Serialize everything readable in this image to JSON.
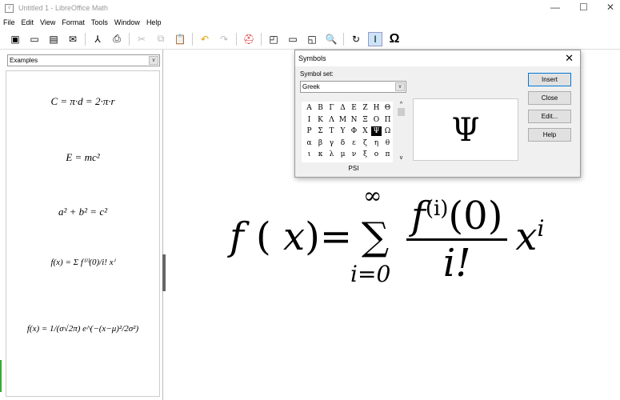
{
  "window": {
    "title": "Untitled 1 - LibreOffice Math",
    "minimize": "—",
    "maximize": "☐",
    "close": "✕"
  },
  "menu": [
    "File",
    "Edit",
    "View",
    "Format",
    "Tools",
    "Window",
    "Help"
  ],
  "toolbar": {
    "icons": [
      "new-formula-icon",
      "open-icon",
      "save-icon",
      "email-icon",
      "export-pdf-icon",
      "print-icon",
      "cut-icon",
      "copy-icon",
      "paste-icon",
      "undo-icon",
      "redo-icon",
      "help-icon",
      "zoom-in-icon",
      "zoom-out-icon",
      "show-all-icon",
      "zoom-icon",
      "update-icon",
      "formula-cursor-icon",
      "symbols-icon"
    ],
    "glyphs": [
      "▣",
      "▭",
      "▤",
      "✉",
      "⅄",
      "⎙",
      "✂",
      "⧉",
      "📋",
      "↶",
      "↷",
      "⛑",
      "◰",
      "▭",
      "◱",
      "🔍",
      "↻",
      "I",
      "Ω"
    ]
  },
  "left_panel": {
    "dropdown": "Examples",
    "examples": [
      "C = π·d = 2·π·r",
      "E = mc²",
      "a² + b² = c²",
      "f(x) = Σ f⁽ⁱ⁾(0)/i! xⁱ",
      "f(x) = 1/(σ√2π) e^(−(x−μ)²/2σ²)"
    ]
  },
  "formula": {
    "f": "f",
    "x": "x",
    "inf": "∞",
    "sum": "∑",
    "lower": "i=0",
    "num_f": "f",
    "num_sup": "(i)",
    "num_arg": "(0)",
    "den": "i!",
    "xi": "x",
    "i": "i"
  },
  "dialog": {
    "title": "Symbols",
    "symbol_set_label": "Symbol set:",
    "symbol_set": "Greek",
    "symbols": [
      "Α",
      "Β",
      "Γ",
      "Δ",
      "Ε",
      "Ζ",
      "Η",
      "Θ",
      "Ι",
      "Κ",
      "Λ",
      "Μ",
      "Ν",
      "Ξ",
      "Ο",
      "Π",
      "Ρ",
      "Σ",
      "Τ",
      "Υ",
      "Φ",
      "Χ",
      "Ψ",
      "Ω",
      "α",
      "β",
      "γ",
      "δ",
      "ε",
      "ζ",
      "η",
      "θ",
      "ι",
      "κ",
      "λ",
      "μ",
      "ν",
      "ξ",
      "ο",
      "π"
    ],
    "selected": "Ψ",
    "selected_name": "PSI",
    "preview": "Ψ",
    "buttons": {
      "insert": "Insert",
      "close": "Close",
      "edit": "Edit...",
      "help": "Help"
    }
  }
}
